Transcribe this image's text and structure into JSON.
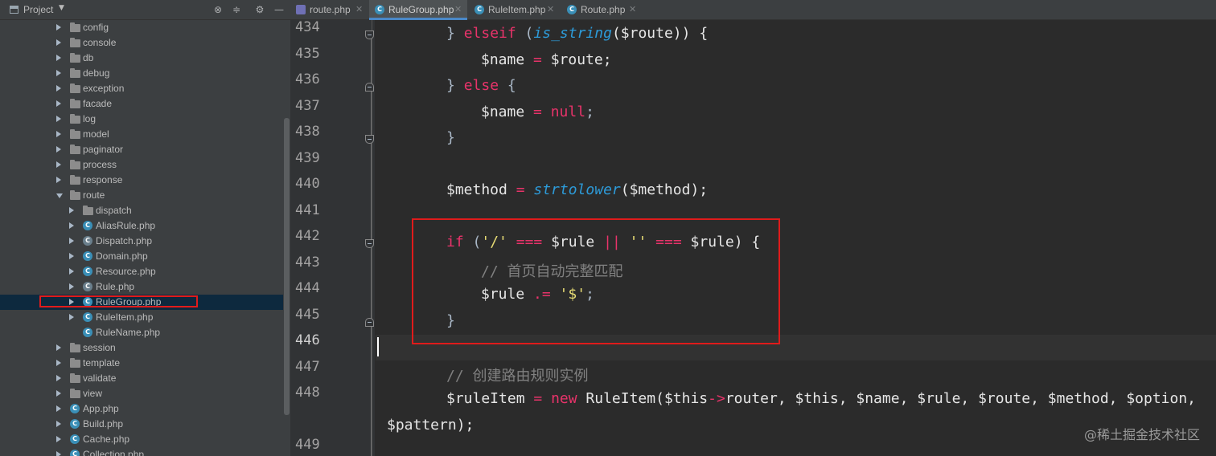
{
  "project_panel": {
    "title": "Project",
    "tree": [
      {
        "label": "config",
        "kind": "folder",
        "depth": 0,
        "state": "closed"
      },
      {
        "label": "console",
        "kind": "folder",
        "depth": 0,
        "state": "closed"
      },
      {
        "label": "db",
        "kind": "folder",
        "depth": 0,
        "state": "closed"
      },
      {
        "label": "debug",
        "kind": "folder",
        "depth": 0,
        "state": "closed"
      },
      {
        "label": "exception",
        "kind": "folder",
        "depth": 0,
        "state": "closed"
      },
      {
        "label": "facade",
        "kind": "folder",
        "depth": 0,
        "state": "closed"
      },
      {
        "label": "log",
        "kind": "folder",
        "depth": 0,
        "state": "closed"
      },
      {
        "label": "model",
        "kind": "folder",
        "depth": 0,
        "state": "closed"
      },
      {
        "label": "paginator",
        "kind": "folder",
        "depth": 0,
        "state": "closed"
      },
      {
        "label": "process",
        "kind": "folder",
        "depth": 0,
        "state": "closed"
      },
      {
        "label": "response",
        "kind": "folder",
        "depth": 0,
        "state": "closed"
      },
      {
        "label": "route",
        "kind": "folder",
        "depth": 0,
        "state": "open"
      },
      {
        "label": "dispatch",
        "kind": "folder",
        "depth": 1,
        "state": "closed"
      },
      {
        "label": "AliasRule.php",
        "kind": "class",
        "depth": 1,
        "state": "closed"
      },
      {
        "label": "Dispatch.php",
        "kind": "abstract",
        "depth": 1,
        "state": "closed"
      },
      {
        "label": "Domain.php",
        "kind": "class",
        "depth": 1,
        "state": "closed"
      },
      {
        "label": "Resource.php",
        "kind": "class",
        "depth": 1,
        "state": "closed"
      },
      {
        "label": "Rule.php",
        "kind": "abstract",
        "depth": 1,
        "state": "closed"
      },
      {
        "label": "RuleGroup.php",
        "kind": "class",
        "depth": 1,
        "state": "closed",
        "selected": true
      },
      {
        "label": "RuleItem.php",
        "kind": "class",
        "depth": 1,
        "state": "closed"
      },
      {
        "label": "RuleName.php",
        "kind": "class",
        "depth": 1,
        "state": "none"
      },
      {
        "label": "session",
        "kind": "folder",
        "depth": 0,
        "state": "closed"
      },
      {
        "label": "template",
        "kind": "folder",
        "depth": 0,
        "state": "closed"
      },
      {
        "label": "validate",
        "kind": "folder",
        "depth": 0,
        "state": "closed"
      },
      {
        "label": "view",
        "kind": "folder",
        "depth": 0,
        "state": "closed"
      },
      {
        "label": "App.php",
        "kind": "class",
        "depth": 0,
        "state": "closed"
      },
      {
        "label": "Build.php",
        "kind": "class",
        "depth": 0,
        "state": "closed"
      },
      {
        "label": "Cache.php",
        "kind": "class",
        "depth": 0,
        "state": "closed"
      },
      {
        "label": "Collection.php",
        "kind": "class",
        "depth": 0,
        "state": "closed"
      }
    ]
  },
  "tabs": [
    {
      "label": "route.php",
      "icon": "php-file-icon",
      "active": false
    },
    {
      "label": "RuleGroup.php",
      "icon": "class-icon",
      "active": true
    },
    {
      "label": "RuleItem.php",
      "icon": "class-icon",
      "active": false
    },
    {
      "label": "Route.php",
      "icon": "class-icon",
      "active": false
    }
  ],
  "editor": {
    "line_numbers": [
      "434",
      "435",
      "436",
      "437",
      "438",
      "439",
      "440",
      "441",
      "442",
      "443",
      "444",
      "445",
      "446",
      "447",
      "448",
      "",
      "449"
    ],
    "current_line": "446"
  },
  "code": {
    "l434": {
      "a": "} ",
      "b": "elseif",
      "c": " (",
      "d": "is_string",
      "e": "($route)) {"
    },
    "l435": {
      "a": "$name",
      "b": " = ",
      "c": "$route;"
    },
    "l436": {
      "a": "} ",
      "b": "else",
      "c": " {"
    },
    "l437": {
      "a": "$name",
      "b": " = ",
      "c": "null",
      "d": ";"
    },
    "l438": {
      "a": "}"
    },
    "l440": {
      "a": "$method",
      "b": " = ",
      "c": "strtolower",
      "d": "($method);"
    },
    "l442": {
      "a": "if",
      "b": " (",
      "c": "'/'",
      "d": " === ",
      "e": "$rule ",
      "f": "||",
      "g": " ",
      "h": "''",
      "i": " === ",
      "j": "$rule) {"
    },
    "l443": {
      "a": "// 首页自动完整匹配"
    },
    "l444": {
      "a": "$rule",
      "b": " .= ",
      "c": "'$'",
      "d": ";"
    },
    "l445": {
      "a": "}"
    },
    "l447": {
      "a": "// 创建路由规则实例"
    },
    "l448": {
      "a": "$ruleItem",
      "b": " = ",
      "c": "new",
      "d": " RuleItem($this",
      "e": "->",
      "f": "router, $this, $name, $rule, $route, $method, $option,"
    },
    "l448b": {
      "a": "$pattern);"
    }
  },
  "watermark": "@稀土掘金技术社区",
  "colors": {
    "highlight_box": "#e01b1b",
    "keyword": "#e8336a",
    "function": "#2d9bd9",
    "string": "#e6db74",
    "comment": "#808080"
  }
}
